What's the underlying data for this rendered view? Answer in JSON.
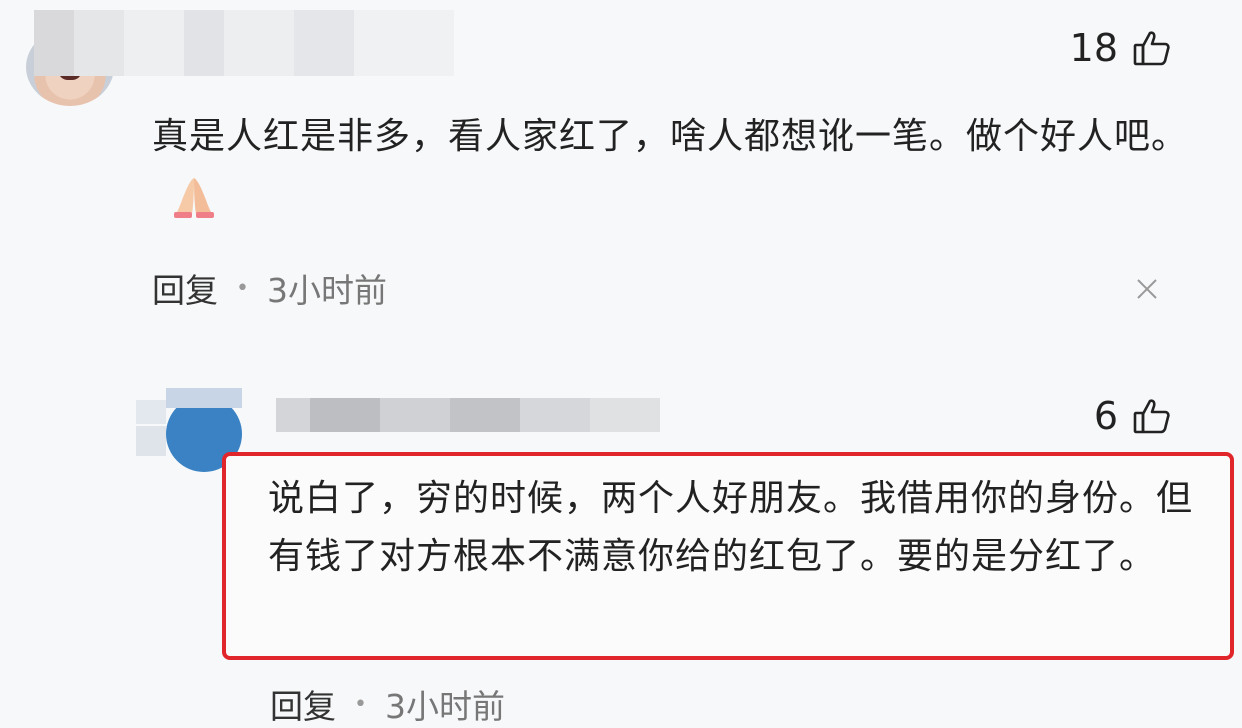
{
  "comments": [
    {
      "likes": "18",
      "text": "真是人红是非多，看人家红了，啥人都想讹一笔。做个好人吧。",
      "reply_label": "回复",
      "time": "3小时前"
    },
    {
      "likes": "6",
      "text": "说白了，穷的时候，两个人好朋友。我借用你的身份。但有钱了对方根本不满意你给的红包了。要的是分红了。",
      "reply_label": "回复",
      "time": "3小时前"
    }
  ],
  "colors": {
    "highlight_border": "#e0262b",
    "background": "#f7f8fa"
  },
  "icons": {
    "like": "thumbs-up-outline-icon",
    "close": "close-icon",
    "emoji": "folded-hands-emoji"
  }
}
